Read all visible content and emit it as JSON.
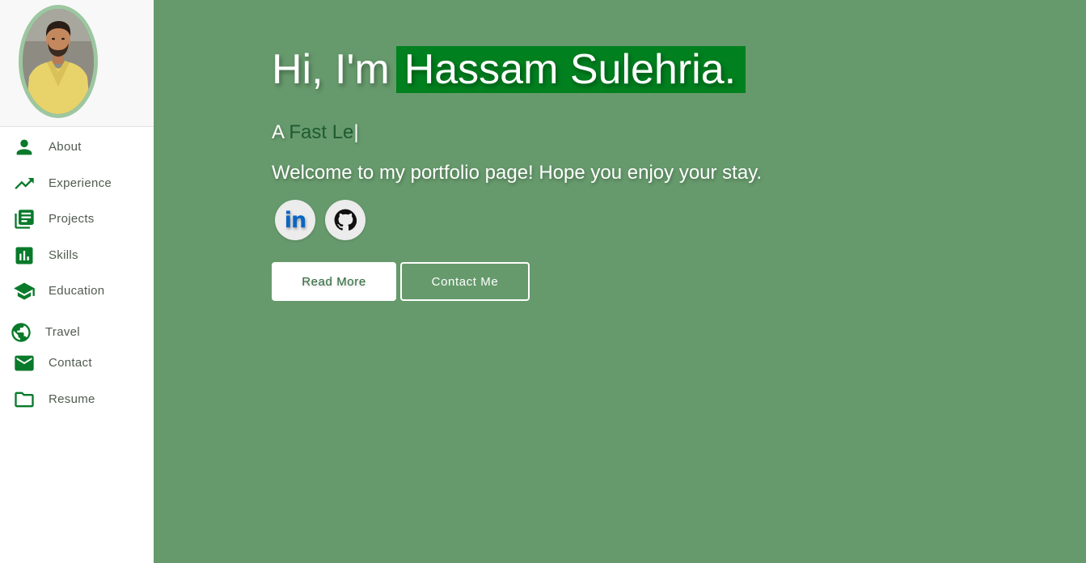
{
  "profile": {
    "photo_alt": "Profile photo"
  },
  "nav": [
    {
      "label": "About",
      "icon": "person-icon"
    },
    {
      "label": "Experience",
      "icon": "trending-up-icon"
    },
    {
      "label": "Projects",
      "icon": "library-books-icon"
    },
    {
      "label": "Skills",
      "icon": "bar-chart-icon"
    },
    {
      "label": "Education",
      "icon": "graduation-cap-icon"
    },
    {
      "label": "Travel",
      "icon": "globe-icon"
    },
    {
      "label": "Contact",
      "icon": "mail-icon"
    },
    {
      "label": "Resume",
      "icon": "folder-icon"
    }
  ],
  "hero": {
    "greeting": "Hi, I'm",
    "name": "Hassam Sulehria.",
    "typing_prefix": "A",
    "typing_text": "Fast Le",
    "caret": "|",
    "welcome": "Welcome to my portfolio page! Hope you enjoy your stay.",
    "social": {
      "linkedin_label": "in",
      "linkedin_icon": "linkedin-icon",
      "github_icon": "github-icon"
    },
    "read_more_label": "Read More",
    "contact_label": "Contact Me"
  },
  "colors": {
    "background": "#669a6c",
    "accent": "#087a2a",
    "name_highlight": "#00801f",
    "avatar_ring": "#9cc7a0"
  }
}
